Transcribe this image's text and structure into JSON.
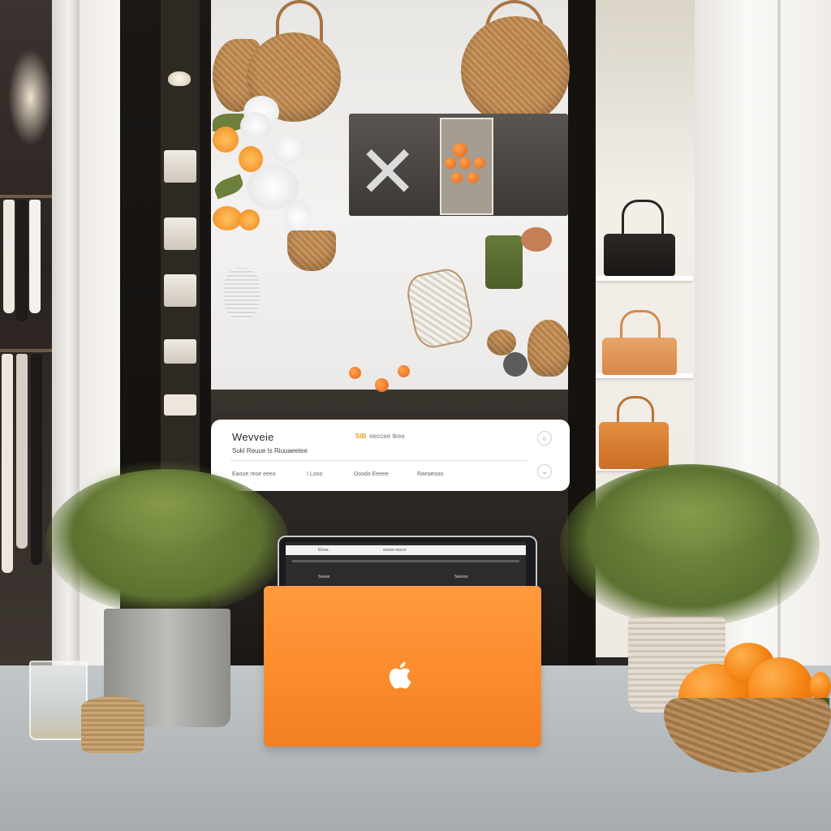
{
  "popup": {
    "title": "Wevveie",
    "tag_highlight": "SIB",
    "tag_text": "eeccee tkea",
    "subtitle": "Sukl Reuue Is Riuuaeetee",
    "meta": [
      "Eaooe reoe eeeo",
      "I Looo",
      "Doodo Eeeee",
      "Raeaeooo"
    ]
  },
  "laptop": {
    "screen_bar_left": "Elcea",
    "screen_bar_center": "eeeee eecce",
    "screen_row_label": "Soeee",
    "screen_row_right": "Seeoce"
  },
  "colors": {
    "laptop_orange": "#fb8a2b",
    "popup_accent": "#e8a21b",
    "table": "#b8bdc0"
  },
  "icons": [
    "apple-logo-icon",
    "circle-icon",
    "chevron-down-icon"
  ]
}
